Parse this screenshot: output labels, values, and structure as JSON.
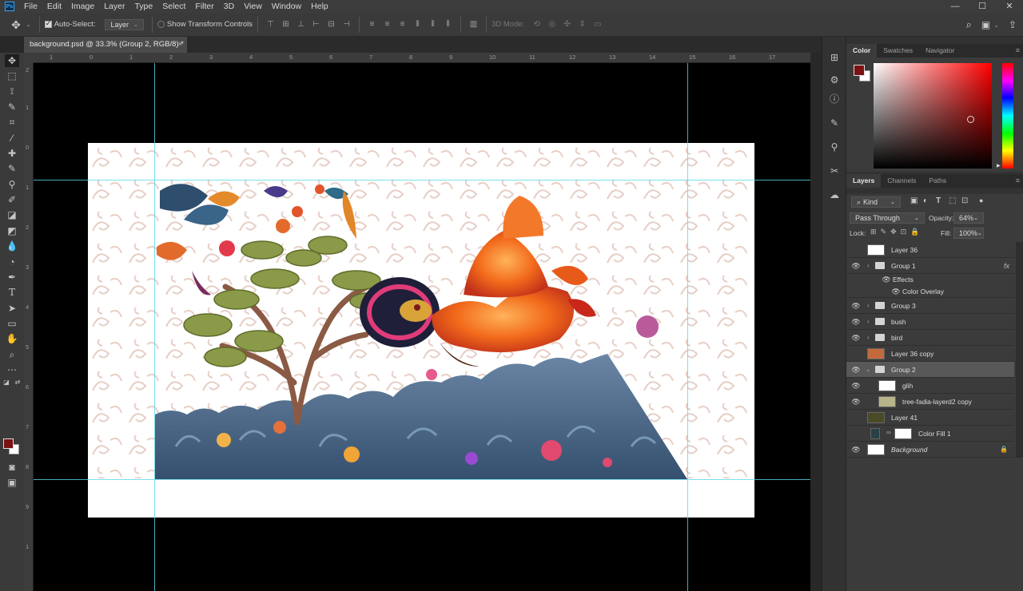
{
  "app": {
    "logo": "Ps"
  },
  "menubar": {
    "items": [
      "File",
      "Edit",
      "Image",
      "Layer",
      "Type",
      "Select",
      "Filter",
      "3D",
      "View",
      "Window",
      "Help"
    ]
  },
  "window_controls": {
    "minimize": "—",
    "maximize": "☐",
    "close": "✕"
  },
  "options": {
    "tool_icon": "move-tool-icon",
    "auto_select_label": "Auto-Select:",
    "auto_select_checked": true,
    "auto_select_target": "Layer",
    "transform_controls_label": "Show Transform Controls",
    "mode_label": "3D Mode:"
  },
  "document": {
    "tab_title": "background.psd @ 33.3% (Group 2, RGB/8) *",
    "close": "×"
  },
  "rulers": {
    "h": [
      "1",
      "0",
      "1",
      "2",
      "3",
      "4",
      "5",
      "6",
      "7",
      "8",
      "9",
      "10",
      "11",
      "12",
      "13",
      "14",
      "15",
      "16",
      "17"
    ],
    "v": [
      "2",
      "1",
      "0",
      "1",
      "2",
      "3",
      "4",
      "5",
      "6",
      "7",
      "8",
      "9",
      "1"
    ]
  },
  "colors": {
    "foreground": "#7a1212",
    "background": "#ffffff",
    "guide": "#5ad7e6"
  },
  "color_panel": {
    "tabs": [
      "Color",
      "Swatches",
      "Navigator"
    ],
    "active": "Color"
  },
  "layers_panel": {
    "tabs": [
      "Layers",
      "Channels",
      "Paths"
    ],
    "active": "Layers",
    "filter_label": "Kind",
    "blend_mode": "Pass Through",
    "opacity_label": "Opacity:",
    "opacity": "64%",
    "lock_label": "Lock:",
    "fill_label": "Fill:",
    "fill": "100%",
    "layers": [
      {
        "name": "Layer 36",
        "visible": false,
        "kind": "thumb",
        "indent": 0
      },
      {
        "name": "Group 1",
        "visible": true,
        "kind": "folder",
        "indent": 0,
        "fx": "fx"
      },
      {
        "name": "Effects",
        "visible": true,
        "kind": "effect",
        "indent": 1
      },
      {
        "name": "Color Overlay",
        "visible": true,
        "kind": "effect",
        "indent": 2
      },
      {
        "name": "Group 3",
        "visible": true,
        "kind": "folder",
        "indent": 0
      },
      {
        "name": "bush",
        "visible": true,
        "kind": "folder",
        "indent": 0
      },
      {
        "name": "bird",
        "visible": true,
        "kind": "folder",
        "indent": 0
      },
      {
        "name": "Layer 36 copy",
        "visible": false,
        "kind": "thumb",
        "indent": 0
      },
      {
        "name": "Group 2",
        "visible": true,
        "kind": "folder-open",
        "indent": 0,
        "selected": true
      },
      {
        "name": "glih",
        "visible": true,
        "kind": "thumb",
        "indent": 1
      },
      {
        "name": "tree-fadia-layerd2 copy",
        "visible": true,
        "kind": "thumb",
        "indent": 1
      },
      {
        "name": "Layer 41",
        "visible": false,
        "kind": "thumb",
        "indent": 0
      },
      {
        "name": "Color Fill 1",
        "visible": false,
        "kind": "fill",
        "indent": 0
      },
      {
        "name": "Background",
        "visible": true,
        "kind": "thumb",
        "indent": 0,
        "italic": true,
        "locked": true
      }
    ]
  }
}
